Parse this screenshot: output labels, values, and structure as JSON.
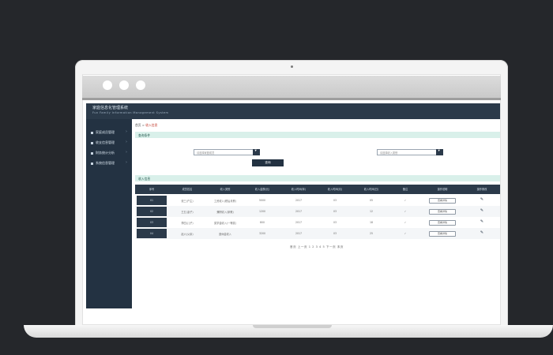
{
  "app": {
    "title": "家庭信息化管理系统",
    "subtitle": "Fun Family Information Management System"
  },
  "sidebar": {
    "items": [
      {
        "label": "家庭成员管理"
      },
      {
        "label": "收支信息管理"
      },
      {
        "label": "财务统计分析"
      },
      {
        "label": "系统信息管理"
      }
    ]
  },
  "breadcrumb": {
    "home": "首页",
    "separator": ">",
    "current": "收入信息"
  },
  "filter": {
    "section_title": "查询条件",
    "select_left": "请选择家庭成员",
    "select_right": "请选择收入类别",
    "search_label": "查询"
  },
  "table": {
    "section_title": "收入信息",
    "headers": [
      "序号",
      "成员姓名",
      "收入类别",
      "收入金额(元)",
      "收入时间(年)",
      "收入时间(月)",
      "收入时间(日)",
      "备注",
      "操作说明",
      "操作修改"
    ],
    "rows": [
      {
        "id": "01",
        "name": "张三(户主)",
        "category": "工资收入(税后月薪)",
        "amount": "5000",
        "year": "2017",
        "month": "03",
        "day": "05",
        "note": "✓",
        "action": "查看详情"
      },
      {
        "id": "02",
        "name": "王五(妻子)",
        "category": "兼职收入(家教)",
        "amount": "1200",
        "year": "2017",
        "month": "03",
        "day": "12",
        "note": "✓",
        "action": "查看详情"
      },
      {
        "id": "03",
        "name": "李四(儿子)",
        "category": "奖学金收入(一等奖)",
        "amount": "800",
        "year": "2017",
        "month": "03",
        "day": "18",
        "note": "✓",
        "action": "查看详情"
      },
      {
        "id": "04",
        "name": "赵六(父亲)",
        "category": "退休金收入",
        "amount": "3200",
        "year": "2017",
        "month": "03",
        "day": "25",
        "note": "✓",
        "action": "查看详情"
      }
    ],
    "edit_icon": "pencil-icon"
  },
  "pager": {
    "text": "首页 上一页 1 2 3 4 5 下一页 末页"
  }
}
